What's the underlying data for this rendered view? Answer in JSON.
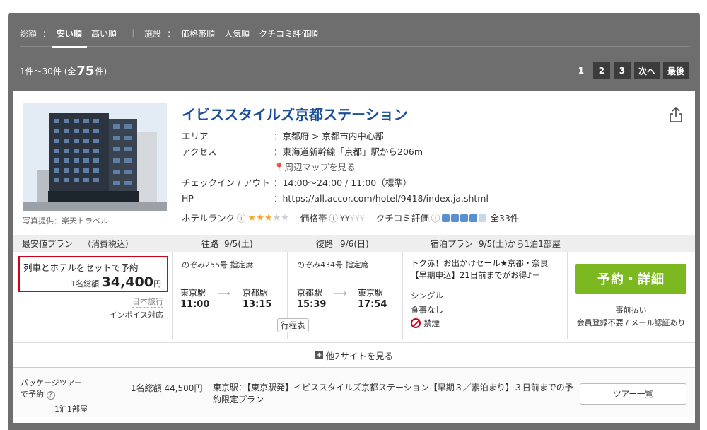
{
  "sort": {
    "label": "総額",
    "colon1": "：",
    "cheap": "安い順",
    "expensive": "高い順",
    "separator": "｜",
    "facility_label": "施設",
    "colon2": "：",
    "price_band": "価格帯順",
    "popular": "人気順",
    "review": "クチコミ評価順"
  },
  "count": {
    "prefix": "1件〜30件 (全",
    "total": "75",
    "suffix": "件)"
  },
  "pager": {
    "p1": "1",
    "p2": "2",
    "p3": "3",
    "next": "次へ",
    "last": "最後"
  },
  "hotel": {
    "name": "イビススタイルズ京都ステーション",
    "photo_credit": "写真提供：楽天トラベル",
    "area_label": "エリア",
    "area_value": "：京都府 > 京都市内中心部",
    "access_label": "アクセス",
    "access_value": "：東海道新幹線「京都」駅から206m",
    "map_link": "周辺マップを見る",
    "checkin_label": "チェックイン / アウト",
    "checkin_value": "：14:00〜24:00 / 11:00（標準）",
    "hp_label": "HP",
    "hp_value": "：https://all.accor.com/hotel/9418/index.ja.shtml",
    "rank_label": "ホテルランク",
    "rank_stars": 3,
    "price_band_label": "価格帯",
    "price_band_level": 2,
    "review_label": "クチコミ評価",
    "review_level": 4,
    "review_count": "全33件",
    "info_mark": "ⓘ"
  },
  "plan_header": {
    "cheapest": "最安値プラン",
    "tax": "（消費税込）",
    "outbound_label": "往路",
    "outbound_date": "9/5(土)",
    "return_label": "復路",
    "return_date": "9/6(日)",
    "stay_label": "宿泊プラン",
    "stay_value": "9/5(土)から1泊1部屋"
  },
  "plan": {
    "set_text": "列車とホテルをセットで予約",
    "price_prefix": "1名総額",
    "price": "34,400",
    "price_unit": "円",
    "agent": "日本旅行",
    "invoice": "インボイス対応",
    "outbound": {
      "train": "のぞみ255号 指定席",
      "from_station": "東京駅",
      "from_time": "11:00",
      "to_station": "京都駅",
      "to_time": "13:15"
    },
    "return": {
      "train": "のぞみ434号 指定席",
      "from_station": "京都駅",
      "from_time": "15:39",
      "to_station": "東京駅",
      "to_time": "17:54"
    },
    "itinerary_button": "行程表",
    "stay_desc": "トク赤！お出かけセール★京都・奈良【早期申込】21日前までがお得♪－",
    "room": "シングル",
    "meal": "食事なし",
    "smoking": "禁煙",
    "reserve_button": "予約・詳細",
    "payment": "事前払い",
    "membership": "会員登録不要 / メール認証あり"
  },
  "more_sites": "他2サイトを見る",
  "package": {
    "label_line1": "パッケージツアー",
    "label_line2": "で予約",
    "help": "?",
    "room": "1泊1部屋",
    "price": "1名総額 44,500円",
    "desc": "東京駅：【東京駅発】イビススタイルズ京都ステーション【早期３／素泊まり】３日前までの予約限定プラン",
    "list_button": "ツアー一覧"
  },
  "colors": {
    "frame_bg": "#6e6e6e",
    "hotel_name": "#1a4f9a",
    "reserve_green": "#7cb820",
    "highlight_red": "#d0021b",
    "star": "#f5a623"
  }
}
